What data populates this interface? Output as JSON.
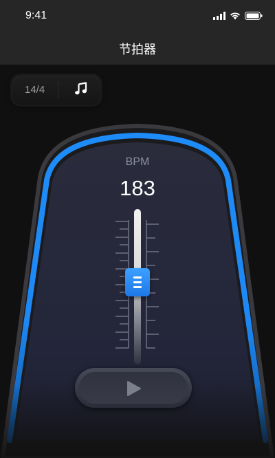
{
  "status_bar": {
    "time": "9:41"
  },
  "nav": {
    "title": "节拍器"
  },
  "time_signature": {
    "value": "14/4"
  },
  "metronome": {
    "bpm_label": "BPM",
    "bpm_value": "183",
    "slider_level": 0.53
  },
  "icons": {
    "signal": "cellular-signal-icon",
    "wifi": "wifi-icon",
    "battery": "battery-icon",
    "music": "music-note-icon",
    "play": "play-icon"
  },
  "colors": {
    "accent": "#1e88f5",
    "body": "#252737",
    "background": "#101010",
    "header": "#262626"
  }
}
